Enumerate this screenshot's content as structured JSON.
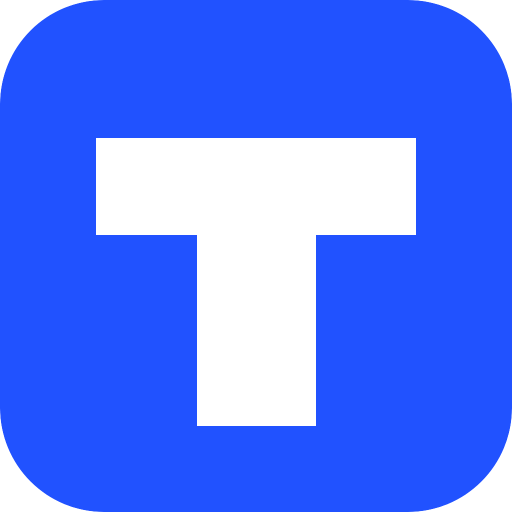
{
  "icon": {
    "name": "t-logo-icon",
    "letter": "T",
    "background_color": "#2152FF",
    "glyph_color": "#FFFFFF"
  }
}
